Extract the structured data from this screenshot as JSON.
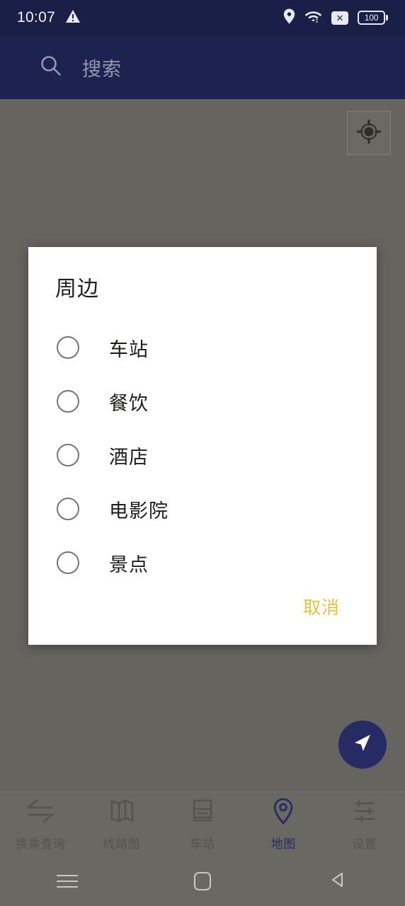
{
  "status_bar": {
    "time": "10:07",
    "warning_icon": "warning-triangle-icon",
    "location_icon": "location-pin-icon",
    "wifi_icon": "wifi-icon",
    "no_sim_icon": "no-sim-icon",
    "no_sim_glyph": "✕",
    "battery_level": "100"
  },
  "search": {
    "icon": "search-icon",
    "placeholder": "搜索",
    "value": ""
  },
  "map": {
    "locate_button_icon": "my-location-crosshair-icon",
    "navigate_fab_icon": "navigation-arrow-icon"
  },
  "dialog": {
    "title": "周边",
    "options": [
      {
        "label": "车站",
        "selected": false
      },
      {
        "label": "餐饮",
        "selected": false
      },
      {
        "label": "酒店",
        "selected": false
      },
      {
        "label": "电影院",
        "selected": false
      },
      {
        "label": "景点",
        "selected": false
      }
    ],
    "cancel_label": "取消",
    "cancel_color": "#e8c13c"
  },
  "bottom_nav": {
    "active_color": "#262b63",
    "inactive_color": "#55534e",
    "items": [
      {
        "label": "换乘查询",
        "icon": "transfer-swap-icon",
        "active": false
      },
      {
        "label": "线路图",
        "icon": "route-map-icon",
        "active": false
      },
      {
        "label": "车站",
        "icon": "train-station-icon",
        "active": false
      },
      {
        "label": "地图",
        "icon": "map-pin-icon",
        "active": true
      },
      {
        "label": "设置",
        "icon": "settings-sliders-icon",
        "active": false
      }
    ]
  },
  "android_nav": {
    "recents_icon": "recents-menu-icon",
    "home_icon": "home-square-icon",
    "back_icon": "back-triangle-icon"
  }
}
